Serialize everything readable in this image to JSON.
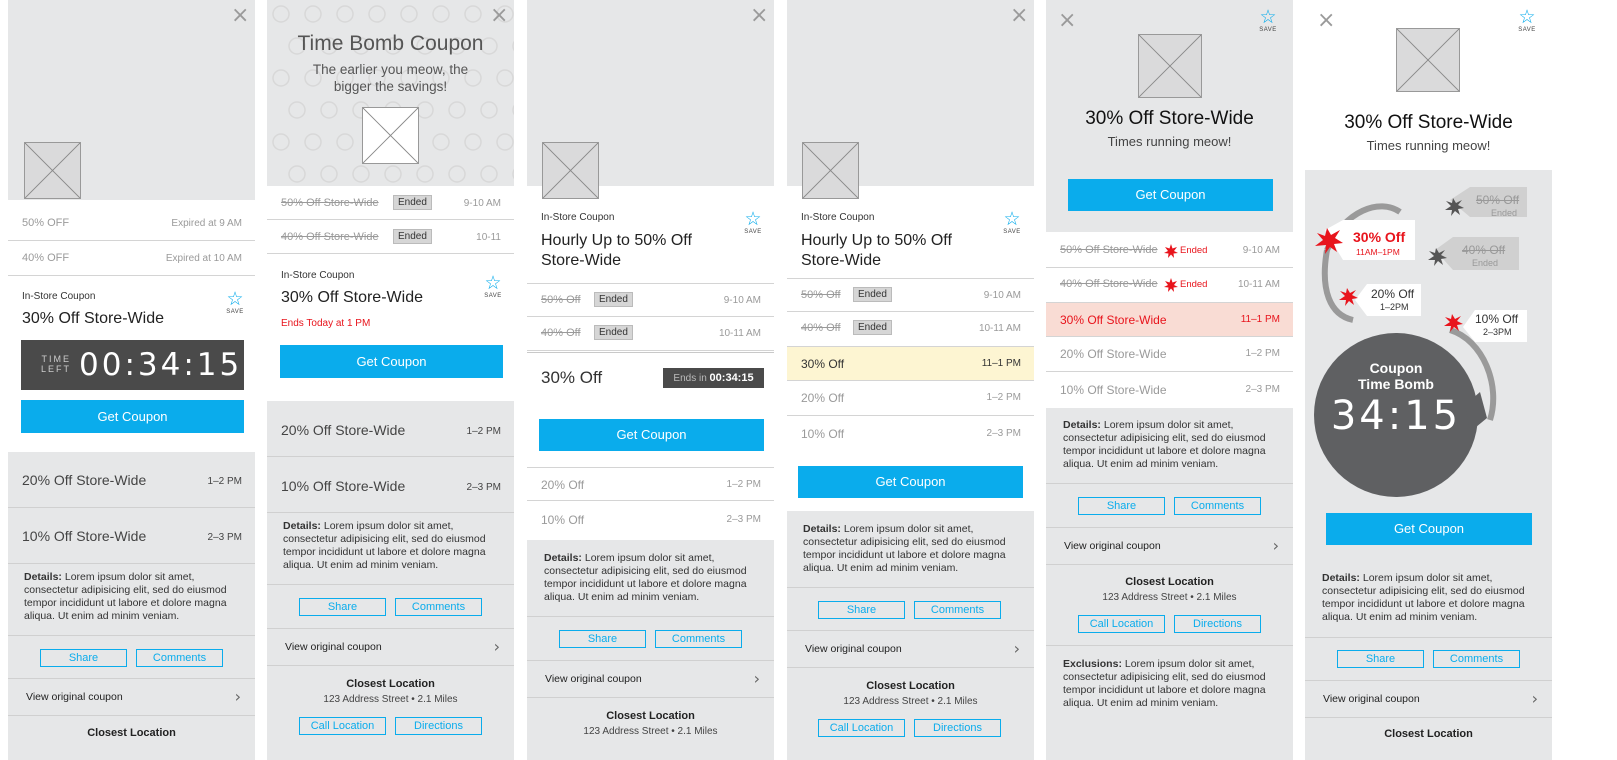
{
  "common": {
    "close": "×",
    "save": "SAVE",
    "get_coupon": "Get Coupon",
    "share": "Share",
    "comments": "Comments",
    "view_original": "View original coupon",
    "chevron": "›",
    "details_label": "Details:",
    "details_text": "Lorem ipsum dolor sit amet, consectetur adipisicing elit, sed do eiusmod tempor incididunt ut labore et dolore magna aliqua. Ut enim ad minim veniam.",
    "closest_location": "Closest Location",
    "address": "123 Address Street • 2.1 Miles",
    "call_location": "Call Location",
    "directions": "Directions",
    "ended": "Ended",
    "in_store": "In-Store Coupon"
  },
  "p1": {
    "expired_rows": [
      {
        "label": "50% OFF",
        "time": "Expired at 9 AM"
      },
      {
        "label": "40% OFF",
        "time": "Expired at 10 AM"
      }
    ],
    "title": "30% Off Store-Wide",
    "timer_label_1": "TIME",
    "timer_label_2": "LEFT",
    "timer": "00:34:15",
    "rows": [
      {
        "label": "20% Off Store-Wide",
        "time": "1–2 PM"
      },
      {
        "label": "10% Off Store-Wide",
        "time": "2–3 PM"
      }
    ]
  },
  "p2": {
    "title": "Time Bomb Coupon",
    "subtitle_1": "The earlier you meow, the",
    "subtitle_2": "bigger the savings!",
    "ended_rows": [
      {
        "label": "50% Off Store-Wide",
        "time": "9-10 AM"
      },
      {
        "label": "40% Off Store-Wide",
        "time": "10-11"
      }
    ],
    "coupon_title": "30% Off Store-Wide",
    "ends": "Ends Today at 1 PM",
    "rows": [
      {
        "label": "20% Off Store-Wide",
        "time": "1–2 PM"
      },
      {
        "label": "10% Off Store-Wide",
        "time": "2–3 PM"
      }
    ]
  },
  "p3": {
    "title_1": "Hourly Up to 50% Off",
    "title_2": "Store-Wide",
    "ended_rows": [
      {
        "label": "50% Off",
        "time": "9-10 AM"
      },
      {
        "label": "40% Off",
        "time": "10-11 AM"
      }
    ],
    "current": "30% Off",
    "ends_in": "Ends in",
    "timer": "00:34:15",
    "rows": [
      {
        "label": "20% Off",
        "time": "1–2 PM"
      },
      {
        "label": "10% Off",
        "time": "2–3 PM"
      }
    ]
  },
  "p4": {
    "title_1": "Hourly Up to 50% Off",
    "title_2": "Store-Wide",
    "ended_rows": [
      {
        "label": "50% Off",
        "time": "9-10 AM"
      },
      {
        "label": "40% Off",
        "time": "10-11 AM"
      }
    ],
    "current": {
      "label": "30% Off",
      "time": "11–1 PM"
    },
    "rows": [
      {
        "label": "20% Off",
        "time": "1–2 PM"
      },
      {
        "label": "10% Off",
        "time": "2–3 PM"
      }
    ]
  },
  "p5": {
    "title": "30% Off Store-Wide",
    "subtitle": "Times running meow!",
    "ended_rows": [
      {
        "label": "50% Off Store-Wide",
        "time": "9-10 AM"
      },
      {
        "label": "40% Off Store-Wide",
        "time": "10-11 AM"
      }
    ],
    "current": {
      "label": "30% Off Store-Wide",
      "time": "11–1 PM"
    },
    "rows": [
      {
        "label": "20% Off Store-Wide",
        "time": "1–2 PM"
      },
      {
        "label": "10% Off Store-Wide",
        "time": "2–3 PM"
      }
    ],
    "exclusions_label": "Exclusions:",
    "exclusions_text": "Lorem ipsum dolor sit amet, consectetur adipisicing elit, sed do eiusmod tempor incididunt ut labore et dolore magna aliqua. Ut enim ad minim veniam."
  },
  "p6": {
    "title": "30% Off Store-Wide",
    "subtitle": "Times running meow!",
    "bomb_title_1": "Coupon",
    "bomb_title_2": "Time Bomb",
    "bomb_timer": "34:15",
    "tags": {
      "t50": {
        "label": "50% Off",
        "sub": "Ended"
      },
      "t40": {
        "label": "40% Off",
        "sub": "Ended"
      },
      "t30": {
        "label": "30% Off",
        "sub": "11AM–1PM"
      },
      "t20": {
        "label": "20% Off",
        "sub": "1–2PM"
      },
      "t10": {
        "label": "10% Off",
        "sub": "2–3PM"
      }
    }
  },
  "colors": {
    "accent": "#0aacec",
    "alert": "#e8141c",
    "highlight_yellow": "#fdf5d2",
    "highlight_red": "#f9dcd4"
  }
}
